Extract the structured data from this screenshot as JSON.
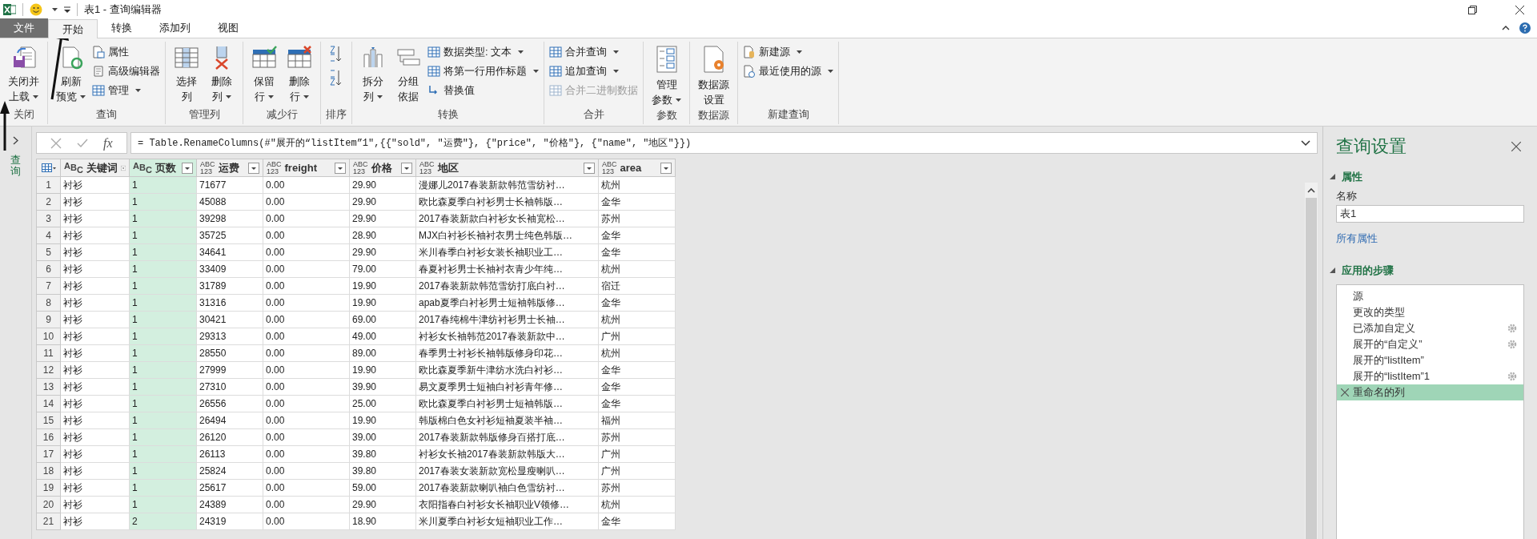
{
  "window": {
    "title": "表1 - 查询编辑器"
  },
  "menu_tabs": [
    {
      "label": "文件",
      "kind": "file",
      "selected": false
    },
    {
      "label": "开始",
      "kind": "tab",
      "selected": true
    },
    {
      "label": "转换",
      "kind": "tab",
      "selected": false
    },
    {
      "label": "添加列",
      "kind": "tab",
      "selected": false
    },
    {
      "label": "视图",
      "kind": "tab",
      "selected": false
    }
  ],
  "ribbon_groups": [
    {
      "label": "关闭",
      "kind": "buttons",
      "items": [
        {
          "kind": "large",
          "lines": [
            "关闭并",
            "上载"
          ],
          "dropdown": true
        }
      ]
    },
    {
      "label": "查询",
      "kind": "buttons",
      "items": [
        {
          "kind": "large",
          "lines": [
            "刷新",
            "预览"
          ],
          "dropdown": true
        },
        {
          "kind": "small",
          "label": "属性",
          "dropdown": false,
          "disabled": false
        },
        {
          "kind": "small",
          "label": "高级编辑器",
          "dropdown": false,
          "disabled": false
        },
        {
          "kind": "small",
          "label": "管理",
          "dropdown": true,
          "disabled": false
        }
      ]
    },
    {
      "label": "管理列",
      "kind": "buttons",
      "items": [
        {
          "kind": "large",
          "lines": [
            "选择",
            "列"
          ],
          "dropdown": false
        },
        {
          "kind": "large",
          "lines": [
            "删除",
            "列"
          ],
          "dropdown": true
        }
      ]
    },
    {
      "label": "减少行",
      "kind": "buttons",
      "items": [
        {
          "kind": "large",
          "lines": [
            "保留",
            "行"
          ],
          "dropdown": true
        },
        {
          "kind": "large",
          "lines": [
            "删除",
            "行"
          ],
          "dropdown": true
        }
      ]
    },
    {
      "label": "排序",
      "kind": "sort"
    },
    {
      "label": "转换",
      "kind": "buttons",
      "items": [
        {
          "kind": "large",
          "lines": [
            "拆分",
            "列"
          ],
          "dropdown": true
        },
        {
          "kind": "large",
          "lines": [
            "分组",
            "依据"
          ],
          "dropdown": false
        },
        {
          "kind": "small",
          "label": "数据类型: 文本",
          "dropdown": true,
          "disabled": false
        },
        {
          "kind": "small",
          "label": "将第一行用作标题",
          "dropdown": true,
          "disabled": false
        },
        {
          "kind": "small",
          "label": "替换值",
          "dropdown": false,
          "disabled": false
        }
      ]
    },
    {
      "label": "合并",
      "kind": "buttons",
      "items": [
        {
          "kind": "small",
          "label": "合并查询",
          "dropdown": true,
          "disabled": false
        },
        {
          "kind": "small",
          "label": "追加查询",
          "dropdown": true,
          "disabled": false
        },
        {
          "kind": "small",
          "label": "合并二进制数据",
          "dropdown": false,
          "disabled": true
        }
      ]
    },
    {
      "label": "参数",
      "kind": "buttons",
      "items": [
        {
          "kind": "large",
          "lines": [
            "管理",
            "参数"
          ],
          "dropdown": true
        }
      ]
    },
    {
      "label": "数据源",
      "kind": "buttons",
      "items": [
        {
          "kind": "large",
          "lines": [
            "数据源",
            "设置"
          ],
          "dropdown": false
        }
      ]
    },
    {
      "label": "新建查询",
      "kind": "buttons",
      "items": [
        {
          "kind": "small",
          "label": "新建源",
          "dropdown": true,
          "disabled": false
        },
        {
          "kind": "small",
          "label": "最近使用的源",
          "dropdown": true,
          "disabled": false
        }
      ]
    }
  ],
  "queries_pane": {
    "label": "查询"
  },
  "formula_bar": {
    "fx": "fx",
    "formula": "= Table.RenameColumns(#\"展开的“listItem”1\",{{\"sold\", \"运费\"}, {\"price\", \"价格\"}, {\"name\", \"地区\"}})"
  },
  "table": {
    "columns": [
      {
        "name": "关键词",
        "kind": "text",
        "type_label": [
          "A",
          "B",
          "C"
        ],
        "selected": false
      },
      {
        "name": "页数",
        "kind": "text",
        "type_label": [
          "A",
          "B",
          "C"
        ],
        "selected": true
      },
      {
        "name": "运费",
        "kind": "any",
        "type_label": [
          "ABC",
          "123"
        ],
        "selected": false
      },
      {
        "name": "freight",
        "kind": "any",
        "type_label": [
          "ABC",
          "123"
        ],
        "selected": false
      },
      {
        "name": "价格",
        "kind": "any",
        "type_label": [
          "ABC",
          "123"
        ],
        "selected": false
      },
      {
        "name": "地区",
        "kind": "any",
        "type_label": [
          "ABC",
          "123"
        ],
        "selected": false
      },
      {
        "name": "area",
        "kind": "any",
        "type_label": [
          "ABC",
          "123"
        ],
        "selected": false
      }
    ],
    "rows": [
      {
        "n": "1",
        "cells": [
          "衬衫",
          "1",
          "71677",
          "0.00",
          "29.90",
          "漫娜儿2017春装新款韩范雪纺衬…",
          "杭州"
        ]
      },
      {
        "n": "2",
        "cells": [
          "衬衫",
          "1",
          "45088",
          "0.00",
          "29.90",
          "欧比森夏季白衬衫男士长袖韩版…",
          "金华"
        ]
      },
      {
        "n": "3",
        "cells": [
          "衬衫",
          "1",
          "39298",
          "0.00",
          "29.90",
          "2017春装新款白衬衫女长袖宽松…",
          "苏州"
        ]
      },
      {
        "n": "4",
        "cells": [
          "衬衫",
          "1",
          "35725",
          "0.00",
          "28.90",
          "MJX白衬衫长袖衬衣男士纯色韩版…",
          "金华"
        ]
      },
      {
        "n": "5",
        "cells": [
          "衬衫",
          "1",
          "34641",
          "0.00",
          "29.90",
          "米川春季白衬衫女装长袖职业工…",
          "金华"
        ]
      },
      {
        "n": "6",
        "cells": [
          "衬衫",
          "1",
          "33409",
          "0.00",
          "79.00",
          "春夏衬衫男士长袖衬衣青少年纯…",
          "杭州"
        ]
      },
      {
        "n": "7",
        "cells": [
          "衬衫",
          "1",
          "31789",
          "0.00",
          "19.90",
          "2017春装新款韩范雪纺打底白衬…",
          "宿迁"
        ]
      },
      {
        "n": "8",
        "cells": [
          "衬衫",
          "1",
          "31316",
          "0.00",
          "19.90",
          "apab夏季白衬衫男士短袖韩版修…",
          "金华"
        ]
      },
      {
        "n": "9",
        "cells": [
          "衬衫",
          "1",
          "30421",
          "0.00",
          "69.00",
          "2017春纯棉牛津纺衬衫男士长袖…",
          "杭州"
        ]
      },
      {
        "n": "10",
        "cells": [
          "衬衫",
          "1",
          "29313",
          "0.00",
          "49.00",
          "衬衫女长袖韩范2017春装新款中…",
          "广州"
        ]
      },
      {
        "n": "11",
        "cells": [
          "衬衫",
          "1",
          "28550",
          "0.00",
          "89.00",
          "春季男士衬衫长袖韩版修身印花…",
          "杭州"
        ]
      },
      {
        "n": "12",
        "cells": [
          "衬衫",
          "1",
          "27999",
          "0.00",
          "19.90",
          "欧比森夏季新牛津纺水洗白衬衫…",
          "金华"
        ]
      },
      {
        "n": "13",
        "cells": [
          "衬衫",
          "1",
          "27310",
          "0.00",
          "39.90",
          "易文夏季男士短袖白衬衫青年修…",
          "金华"
        ]
      },
      {
        "n": "14",
        "cells": [
          "衬衫",
          "1",
          "26556",
          "0.00",
          "25.00",
          "欧比森夏季白衬衫男士短袖韩版…",
          "金华"
        ]
      },
      {
        "n": "15",
        "cells": [
          "衬衫",
          "1",
          "26494",
          "0.00",
          "19.90",
          "韩版棉白色女衬衫短袖夏装半袖…",
          "福州"
        ]
      },
      {
        "n": "16",
        "cells": [
          "衬衫",
          "1",
          "26120",
          "0.00",
          "39.00",
          "2017春装新款韩版修身百搭打底…",
          "苏州"
        ]
      },
      {
        "n": "17",
        "cells": [
          "衬衫",
          "1",
          "26113",
          "0.00",
          "39.80",
          "衬衫女长袖2017春装新款韩版大…",
          "广州"
        ]
      },
      {
        "n": "18",
        "cells": [
          "衬衫",
          "1",
          "25824",
          "0.00",
          "39.80",
          "2017春装女装新款宽松显瘦喇叭…",
          "广州"
        ]
      },
      {
        "n": "19",
        "cells": [
          "衬衫",
          "1",
          "25617",
          "0.00",
          "59.00",
          "2017春装新款喇叭袖白色雪纺衬…",
          "苏州"
        ]
      },
      {
        "n": "20",
        "cells": [
          "衬衫",
          "1",
          "24389",
          "0.00",
          "29.90",
          "衣阳指春白衬衫女长袖职业V领修…",
          "杭州"
        ]
      },
      {
        "n": "21",
        "cells": [
          "衬衫",
          "2",
          "24319",
          "0.00",
          "18.90",
          "米川夏季白衬衫女短袖职业工作…",
          "金华"
        ]
      }
    ]
  },
  "query_settings": {
    "title": "查询设置",
    "properties": {
      "heading": "属性",
      "expanded": true,
      "name_label": "名称",
      "name_value": "表1",
      "all_properties_link": "所有属性"
    },
    "steps_section": {
      "heading": "应用的步骤",
      "expanded": true,
      "steps": [
        {
          "label": "源",
          "settings": false,
          "selected": false
        },
        {
          "label": "更改的类型",
          "settings": false,
          "selected": false
        },
        {
          "label": "已添加自定义",
          "settings": true,
          "selected": false
        },
        {
          "label": "展开的“自定义”",
          "settings": true,
          "selected": false
        },
        {
          "label": "展开的“listItem”",
          "settings": false,
          "selected": false
        },
        {
          "label": "展开的“listItem”1",
          "settings": true,
          "selected": false
        },
        {
          "label": "重命名的列",
          "settings": false,
          "selected": true
        }
      ]
    }
  }
}
